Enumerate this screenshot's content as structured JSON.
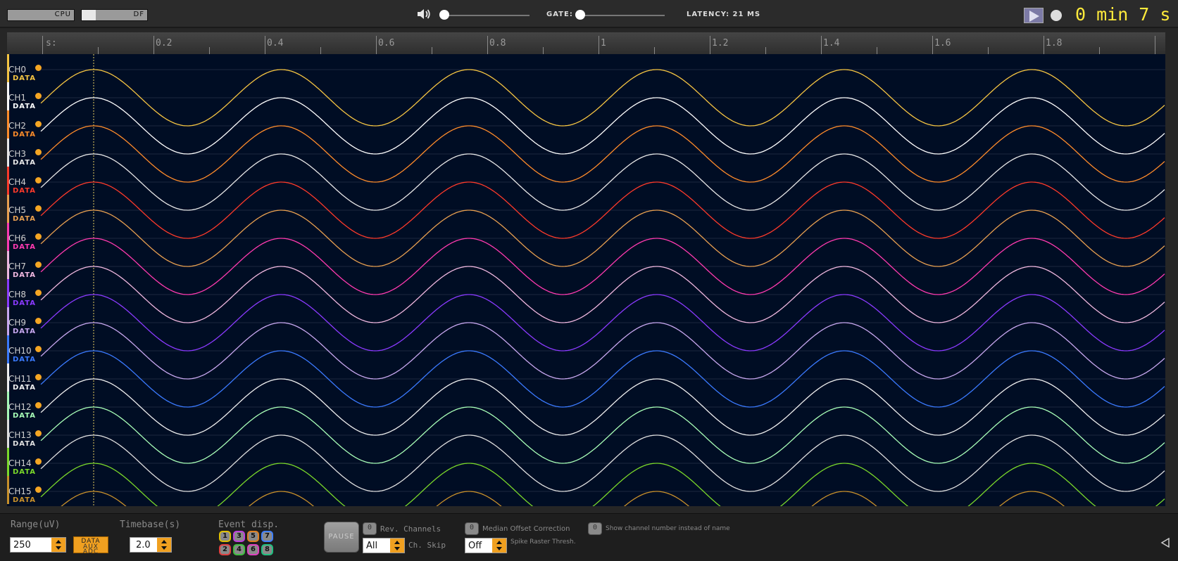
{
  "topbar": {
    "cpu_label": "CPU",
    "cpu_level": 0.0,
    "df_label": "DF",
    "df_level": 0.22,
    "volume_level": 0.0,
    "gate_label": "GATE:",
    "gate_level": 0.0,
    "latency": "LATENCY: 21 MS",
    "timer": "0 min 7 s"
  },
  "ruler": {
    "prefix": "s:",
    "labels": [
      "0.2",
      "0.4",
      "0.6",
      "0.8",
      "1",
      "1.2",
      "1.4",
      "1.6",
      "1.8"
    ]
  },
  "channels": [
    {
      "name": "CH0",
      "type": "DATA",
      "color": "#f5c542"
    },
    {
      "name": "CH1",
      "type": "DATA",
      "color": "#ffffff"
    },
    {
      "name": "CH2",
      "type": "DATA",
      "color": "#ff8c2a"
    },
    {
      "name": "CH3",
      "type": "DATA",
      "color": "#e8e8e8"
    },
    {
      "name": "CH4",
      "type": "DATA",
      "color": "#ff3a2a"
    },
    {
      "name": "CH5",
      "type": "DATA",
      "color": "#e8a050"
    },
    {
      "name": "CH6",
      "type": "DATA",
      "color": "#ff3ab0"
    },
    {
      "name": "CH7",
      "type": "DATA",
      "color": "#f0b8e0"
    },
    {
      "name": "CH8",
      "type": "DATA",
      "color": "#8a3aff"
    },
    {
      "name": "CH9",
      "type": "DATA",
      "color": "#c8a8f0"
    },
    {
      "name": "CH10",
      "type": "DATA",
      "color": "#3a7aff"
    },
    {
      "name": "CH11",
      "type": "DATA",
      "color": "#f0f0f0"
    },
    {
      "name": "CH12",
      "type": "DATA",
      "color": "#a8ffb8"
    },
    {
      "name": "CH13",
      "type": "DATA",
      "color": "#e0e0e0"
    },
    {
      "name": "CH14",
      "type": "DATA",
      "color": "#7ad82a"
    },
    {
      "name": "CH15",
      "type": "DATA",
      "color": "#c8902a"
    }
  ],
  "controls": {
    "range_label": "Range(uV)",
    "range_value": "250",
    "signal_types": [
      "DATA",
      "AUX",
      "ADC"
    ],
    "timebase_label": "Timebase(s)",
    "timebase_value": "2.0",
    "event_label": "Event disp.",
    "events_top": [
      "1",
      "3",
      "5",
      "7"
    ],
    "events_bottom": [
      "2",
      "4",
      "6",
      "8"
    ],
    "event_colors": [
      "#e0c000",
      "#e04040",
      "#c040e0",
      "#40c040",
      "#e08020",
      "#e040c0",
      "#4080ff",
      "#20c080"
    ],
    "pause_label": "PAUSE",
    "rev_channels_btn": "0",
    "rev_channels_label": "Rev. Channels",
    "ch_skip_value": "All",
    "ch_skip_label": "Ch. Skip",
    "median_btn": "0",
    "median_label": "Median Offset Correction",
    "show_num_btn": "0",
    "show_num_label": "Show channel number instead of name",
    "spike_value": "Off",
    "spike_label": "Spike Raster Thresh."
  }
}
